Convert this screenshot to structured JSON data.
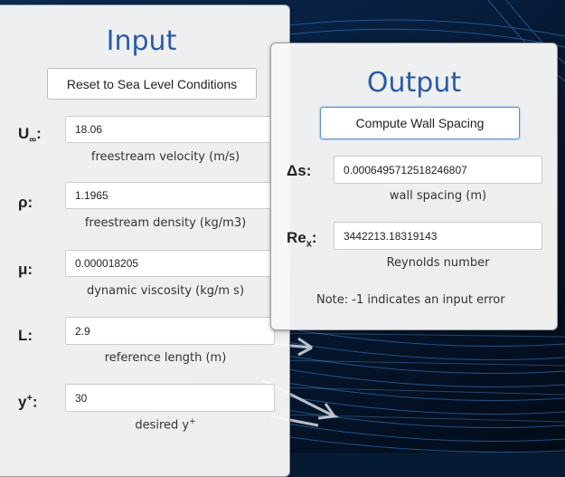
{
  "input": {
    "title": "Input",
    "reset_label": "Reset to Sea Level Conditions",
    "fields": [
      {
        "symbol": "U",
        "symbol_sub": "∞",
        "value": "18.06",
        "description": "freestream velocity (m/s)"
      },
      {
        "symbol": "ρ",
        "value": "1.1965",
        "description": "freestream density (kg/m3)"
      },
      {
        "symbol": "μ",
        "value": "0.000018205",
        "description": "dynamic viscosity (kg/m s)"
      },
      {
        "symbol": "L",
        "value": "2.9",
        "description": "reference length (m)"
      },
      {
        "symbol": "y",
        "symbol_sup": "+",
        "value": "30",
        "description": "desired y",
        "description_sup": "+"
      }
    ]
  },
  "output": {
    "title": "Output",
    "compute_label": "Compute Wall Spacing",
    "fields": [
      {
        "symbol": "Δs",
        "value": "0.0006495712518246807",
        "description": "wall spacing (m)"
      },
      {
        "symbol": "Re",
        "symbol_sub": "x",
        "value": "3442213.18319143",
        "description": "Reynolds number"
      }
    ],
    "note": "Note: -1 indicates an input error"
  },
  "colors": {
    "title": "#2a5ba8",
    "background": "#061a33"
  }
}
